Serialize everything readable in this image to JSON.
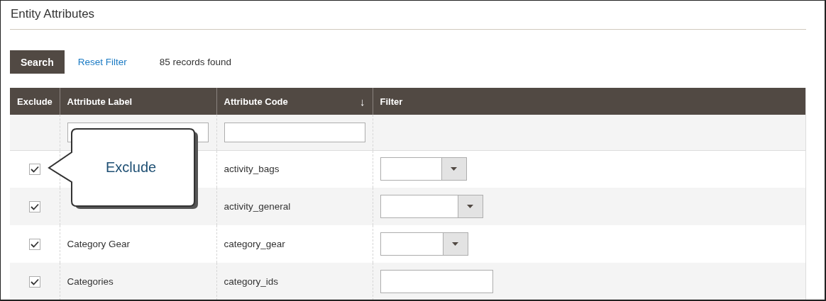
{
  "title": "Entity Attributes",
  "toolbar": {
    "search_button": "Search",
    "reset_link": "Reset Filter",
    "records": "85 records found"
  },
  "table": {
    "columns": [
      {
        "label": "Exclude"
      },
      {
        "label": "Attribute Label"
      },
      {
        "label": "Attribute Code",
        "sort_icon": "↓"
      },
      {
        "label": "Filter"
      }
    ],
    "filter_row": [
      {
        "kind": "none"
      },
      {
        "kind": "text"
      },
      {
        "kind": "text"
      },
      {
        "kind": "none"
      }
    ],
    "rows": [
      {
        "excluded": true,
        "code": "activity_bags",
        "filter": {
          "kind": "select"
        }
      },
      {
        "excluded": true,
        "code": "activity_general",
        "filter": {
          "kind": "select"
        }
      },
      {
        "excluded": true,
        "label": "Category Gear",
        "code": "category_gear",
        "filter": {
          "kind": "select"
        }
      },
      {
        "excluded": true,
        "label": "Categories",
        "code": "category_ids",
        "filter": {
          "kind": "text"
        }
      }
    ]
  },
  "callout": {
    "text": "Exclude"
  }
}
